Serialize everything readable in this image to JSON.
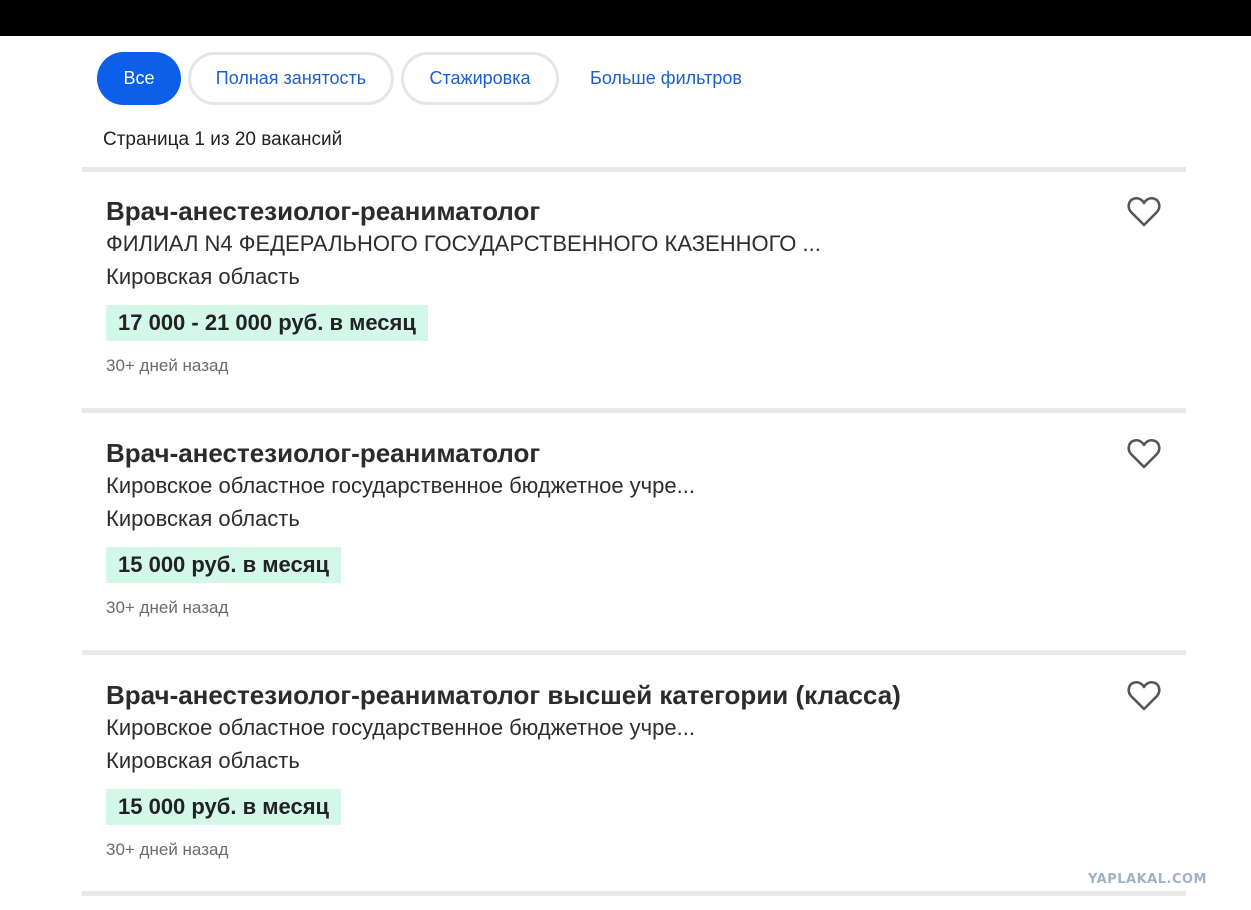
{
  "filters": [
    {
      "label": "Все",
      "active": true
    },
    {
      "label": "Полная занятость",
      "active": false
    },
    {
      "label": "Стажировка",
      "active": false
    }
  ],
  "more_filters_label": "Больше фильтров",
  "page_count": "Страница 1 из 20 вакансий",
  "jobs": [
    {
      "title": "Врач-анестезиолог-реаниматолог",
      "company": "ФИЛИАЛ N4 ФЕДЕРАЛЬНОГО ГОСУДАРСТВЕННОГО КАЗЕННОГО ...",
      "location": "Кировская область",
      "salary": "17 000 - 21 000 руб. в месяц",
      "posted": "30+ дней назад"
    },
    {
      "title": "Врач-анестезиолог-реаниматолог",
      "company": "Кировское областное государственное бюджетное учре...",
      "location": "Кировская область",
      "salary": "15 000 руб. в месяц",
      "posted": "30+ дней назад"
    },
    {
      "title": "Врач-анестезиолог-реаниматолог высшей категории (класса)",
      "company": "Кировское областное государственное бюджетное учре...",
      "location": "Кировская область",
      "salary": "15 000 руб. в месяц",
      "posted": "30+ дней назад"
    }
  ],
  "icons": {
    "favorite": "heart-outline-icon"
  },
  "colors": {
    "accent": "#0b5fe8",
    "link": "#1a5fcf",
    "salary_bg": "#d3f8ea"
  },
  "watermark": "YAPLAKAL.COM"
}
